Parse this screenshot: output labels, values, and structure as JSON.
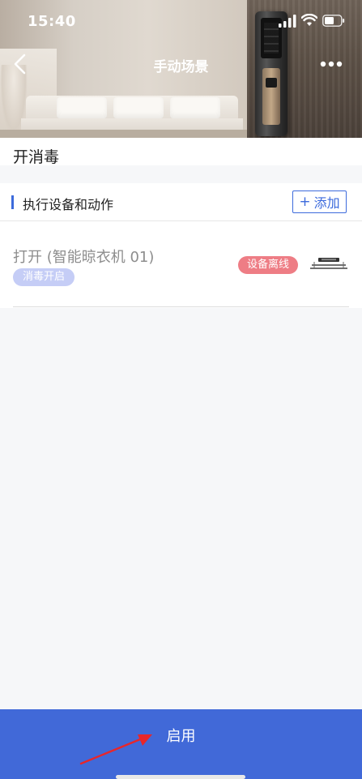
{
  "status_bar": {
    "time": "15:40",
    "icons": [
      "cellular-signal-icon",
      "wifi-icon",
      "battery-icon"
    ]
  },
  "nav": {
    "title": "手动场景",
    "back_icon": "chevron-left-icon",
    "more_icon": "more-dots-icon"
  },
  "scene": {
    "name": "开消毒"
  },
  "actions_section": {
    "title": "执行设备和动作",
    "add_label": "添加",
    "add_icon": "plus-icon",
    "items": [
      {
        "action": "打开 (智能晾衣机 01)",
        "chip": "消毒开启",
        "status_badge": "设备离线",
        "device_icon": "clothes-drying-rack-icon"
      }
    ]
  },
  "footer": {
    "enable_label": "启用"
  },
  "colors": {
    "accent": "#4169d8",
    "link_blue": "#3d6bdc",
    "chip_bg": "#c5cdf6",
    "offline_badge": "#ee7d85",
    "annotation_arrow": "#e8262a"
  }
}
